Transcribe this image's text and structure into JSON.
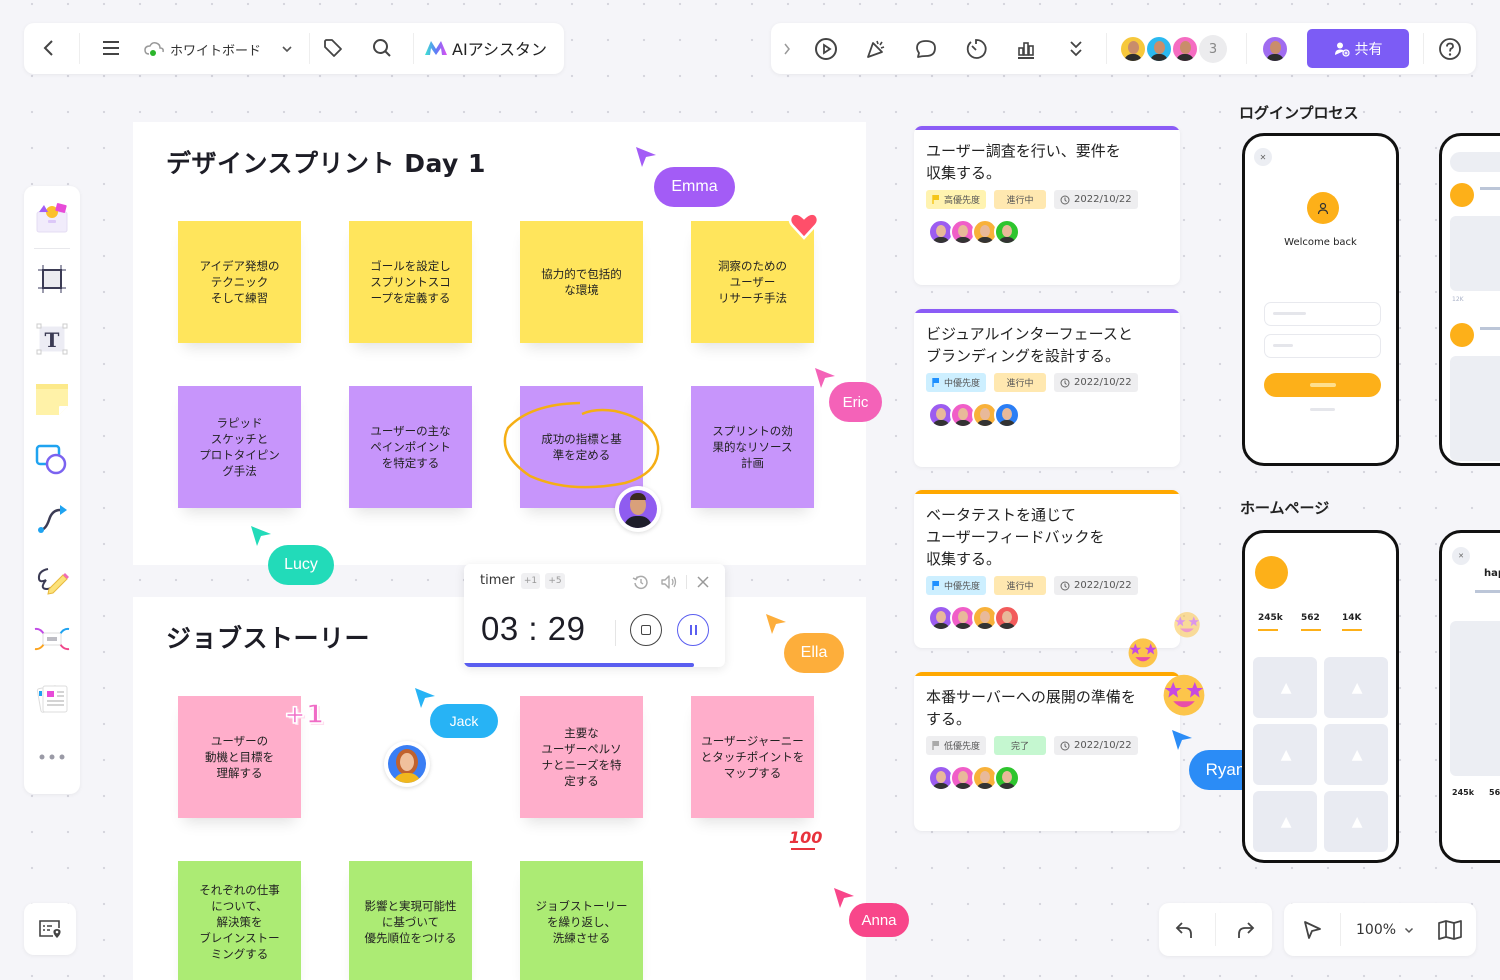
{
  "toolbar_left": {
    "back_icon": "chevron-left-icon",
    "menu_icon": "hamburger-icon",
    "cloud_icon": "cloud-synced-icon",
    "board_name": "ホワイトボード",
    "tag_icon": "tag-icon",
    "search_icon": "search-icon",
    "ai_label": "AIアシスタン"
  },
  "toolbar_right": {
    "collapse_icon": "chevron-right-icon",
    "tools": [
      "play-icon",
      "celebrate-icon",
      "comment-icon",
      "timer-icon",
      "vote-icon",
      "more-icon"
    ],
    "collaborator_count": "3",
    "share_label": "共有",
    "help_icon": "help-icon",
    "accent": "#7c5cf5"
  },
  "sidebar": {
    "tools": [
      "templates",
      "frame",
      "text",
      "sticky-note",
      "shapes",
      "connector",
      "pen",
      "mindmap",
      "cards",
      "more"
    ]
  },
  "board1": {
    "title": "デザインスプリント Day 1",
    "notes_row1": [
      "アイデア発想の\nテクニック\nそして練習",
      "ゴールを設定し\nスプリントスコ\nープを定義する",
      "協力的で包括的\nな環境",
      "洞察のための\nユーザー\nリサーチ手法"
    ],
    "notes_row2": [
      "ラピッド\nスケッチと\nプロトタイピン\nグ手法",
      "ユーザーの主な\nペインポイント\nを特定する",
      "成功の指標と基\n準を定める",
      "スプリントの効\n果的なリソース\n計画"
    ]
  },
  "board2": {
    "title": "ジョブストーリー",
    "notes_row1": [
      "ユーザーの\n動機と目標を\n理解する",
      "主要な\nユーザーペルソ\nナとニーズを特\n定する",
      "ユーザージャーニー\nとタッチポイントを\nマップする"
    ],
    "notes_row2": [
      "それぞれの仕事\nについて、\n解決策を\nブレインストー\nミングする",
      "影響と実現可能性\nに基づいて\n優先順位をつける",
      "ジョブストーリー\nを繰り返し、\n洗練させる"
    ]
  },
  "cursors": {
    "emma": {
      "name": "Emma",
      "color": "#a35cf6"
    },
    "eric": {
      "name": "Eric",
      "color": "#f462b8"
    },
    "lucy": {
      "name": "Lucy",
      "color": "#22dbb9"
    },
    "jack": {
      "name": "Jack",
      "color": "#27b3f5"
    },
    "ella": {
      "name": "Ella",
      "color": "#fdae3b"
    },
    "anna": {
      "name": "Anna",
      "color": "#f8468a"
    },
    "ryan": {
      "name": "Ryan",
      "color": "#2b8cf6"
    }
  },
  "stickers": {
    "heart": "❤",
    "plus_one": "+1",
    "hundred": "100"
  },
  "timer": {
    "label": "timer",
    "plus1": "+1",
    "plus5": "+5",
    "time": "03 : 29",
    "progress": 0.88
  },
  "tasks": [
    {
      "title": "ユーザー調査を行い、要件を\n収集する。",
      "bar_color": "#8b5cf6",
      "priority": "高優先度",
      "priority_bg": "#fff3b0",
      "priority_flag": "#f5c518",
      "status": "進行中",
      "status_bg": "#ffe8b0",
      "date": "2022/10/22"
    },
    {
      "title": "ビジュアルインターフェースと\nブランディングを設計する。",
      "bar_color": "#8b5cf6",
      "priority": "中優先度",
      "priority_bg": "#cdefff",
      "priority_flag": "#1e90ff",
      "status": "進行中",
      "status_bg": "#ffe8b0",
      "date": "2022/10/22"
    },
    {
      "title": "ベータテストを通じて\nユーザーフィードバックを\n収集する。",
      "bar_color": "#ffa800",
      "priority": "中優先度",
      "priority_bg": "#cdefff",
      "priority_flag": "#1e90ff",
      "status": "進行中",
      "status_bg": "#ffe8b0",
      "date": "2022/10/22"
    },
    {
      "title": "本番サーバーへの展開の準備を\nする。",
      "bar_color": "#ffa800",
      "priority": "低優先度",
      "priority_bg": "#eeeef0",
      "priority_flag": "#aaaaaa",
      "status": "完了",
      "status_bg": "#c5f7d0",
      "date": "2022/10/22"
    }
  ],
  "wireframes": {
    "login_label": "ログインプロセス",
    "login_welcome": "Welcome back",
    "feed_likes": "12K",
    "home_label": "ホームページ",
    "stats": [
      "245k",
      "562",
      "14K"
    ],
    "profile_name": "hap",
    "profile_stats": [
      "245k",
      "56"
    ]
  },
  "bottom": {
    "undo_icon": "undo-icon",
    "redo_icon": "redo-icon",
    "select_icon": "pointer-icon",
    "zoom": "100%",
    "map_icon": "map-icon",
    "outline_icon": "outline-icon"
  }
}
